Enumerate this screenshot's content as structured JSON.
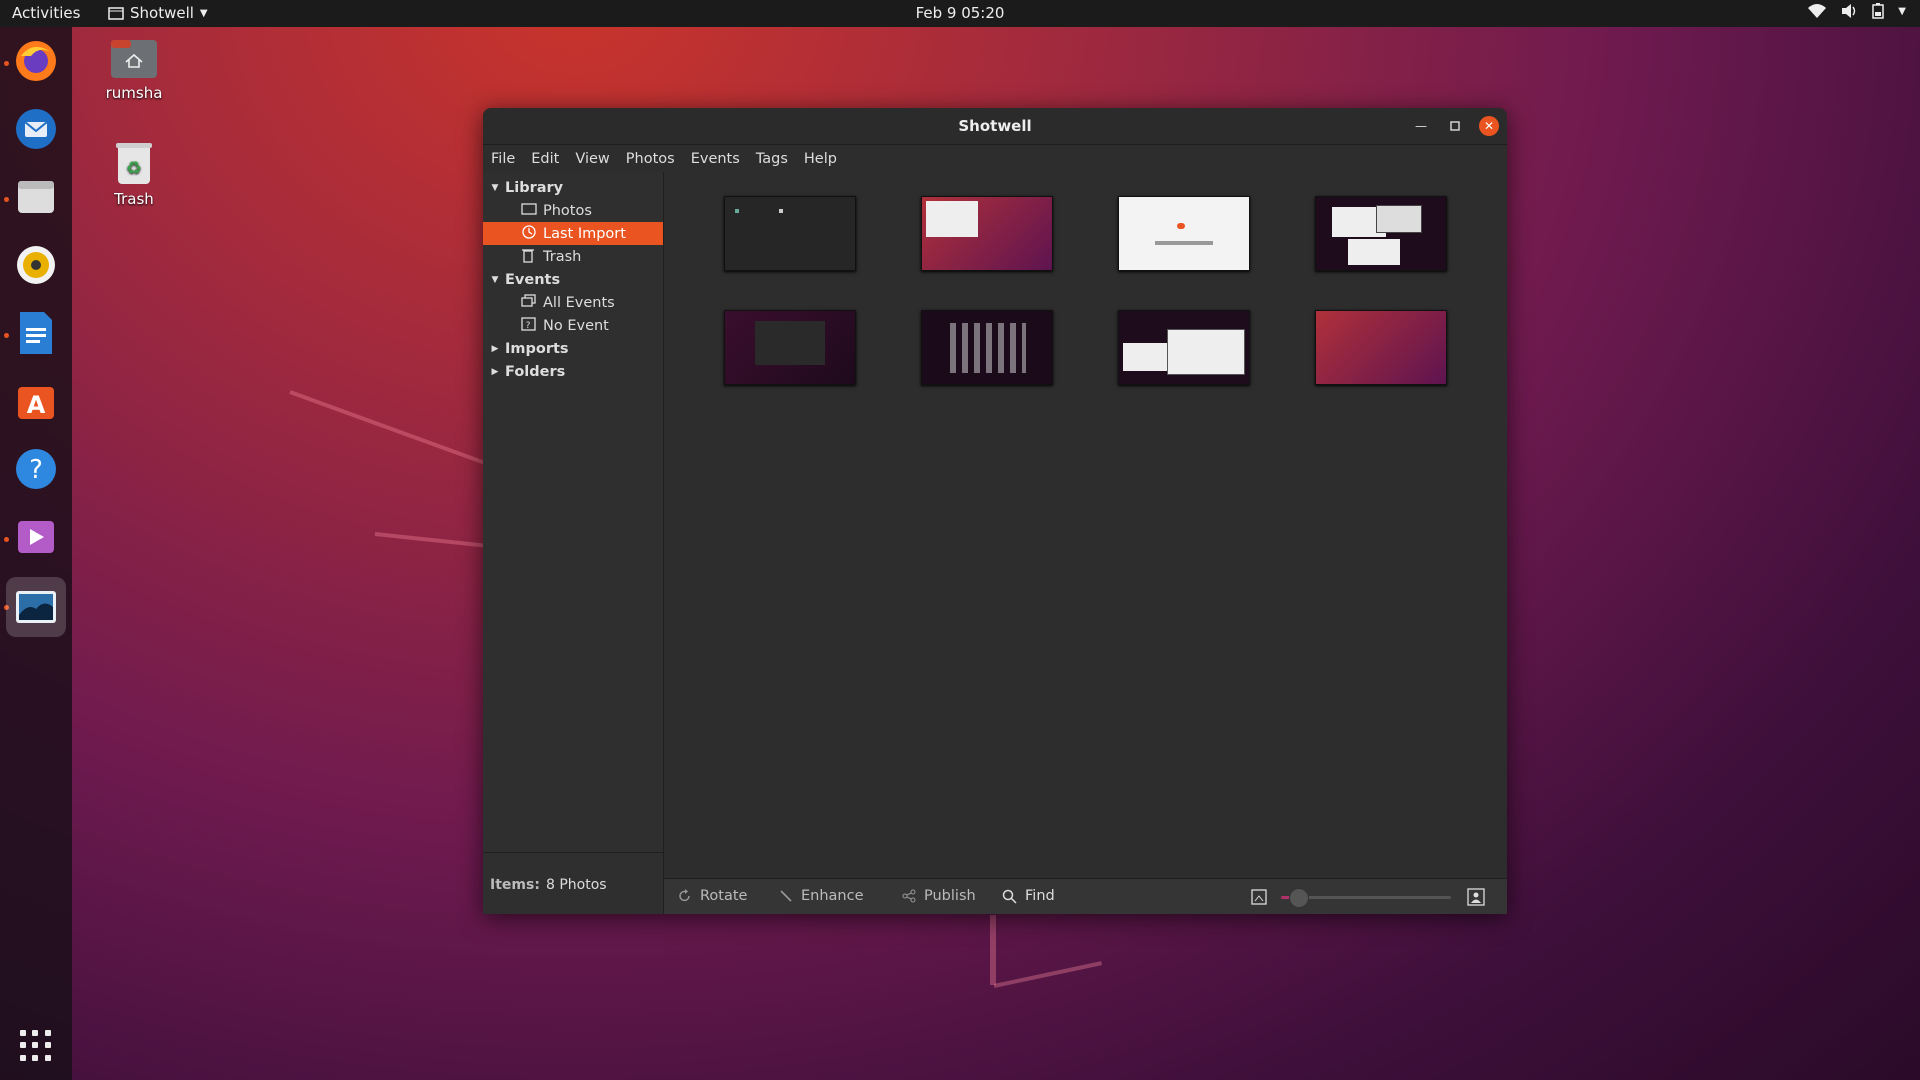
{
  "topbar": {
    "activities": "Activities",
    "app_name": "Shotwell",
    "clock": "Feb 9  05:20"
  },
  "desktop": {
    "home_label": "rumsha",
    "trash_label": "Trash"
  },
  "dock": {
    "items": [
      "firefox-icon",
      "thunderbird-icon",
      "files-icon",
      "rhythmbox-icon",
      "writer-icon",
      "software-icon",
      "help-icon",
      "videos-icon",
      "shotwell-icon"
    ],
    "show_apps": "show-applications-icon"
  },
  "window": {
    "title": "Shotwell",
    "menu": [
      "File",
      "Edit",
      "View",
      "Photos",
      "Events",
      "Tags",
      "Help"
    ],
    "sidebar": {
      "library": "Library",
      "photos": "Photos",
      "last_import": "Last Import",
      "trash": "Trash",
      "events": "Events",
      "all_events": "All Events",
      "no_event": "No Event",
      "imports": "Imports",
      "folders": "Folders"
    },
    "status": {
      "items_label": "Items:",
      "items_value": "8 Photos"
    },
    "toolbar": {
      "rotate": "Rotate",
      "enhance": "Enhance",
      "publish": "Publish",
      "find": "Find",
      "zoom_level": 0.1
    },
    "photos_count": 8
  },
  "colors": {
    "accent": "#e95420",
    "window_bg": "#2d2d2d",
    "topbar_bg": "#1b1b1b"
  }
}
